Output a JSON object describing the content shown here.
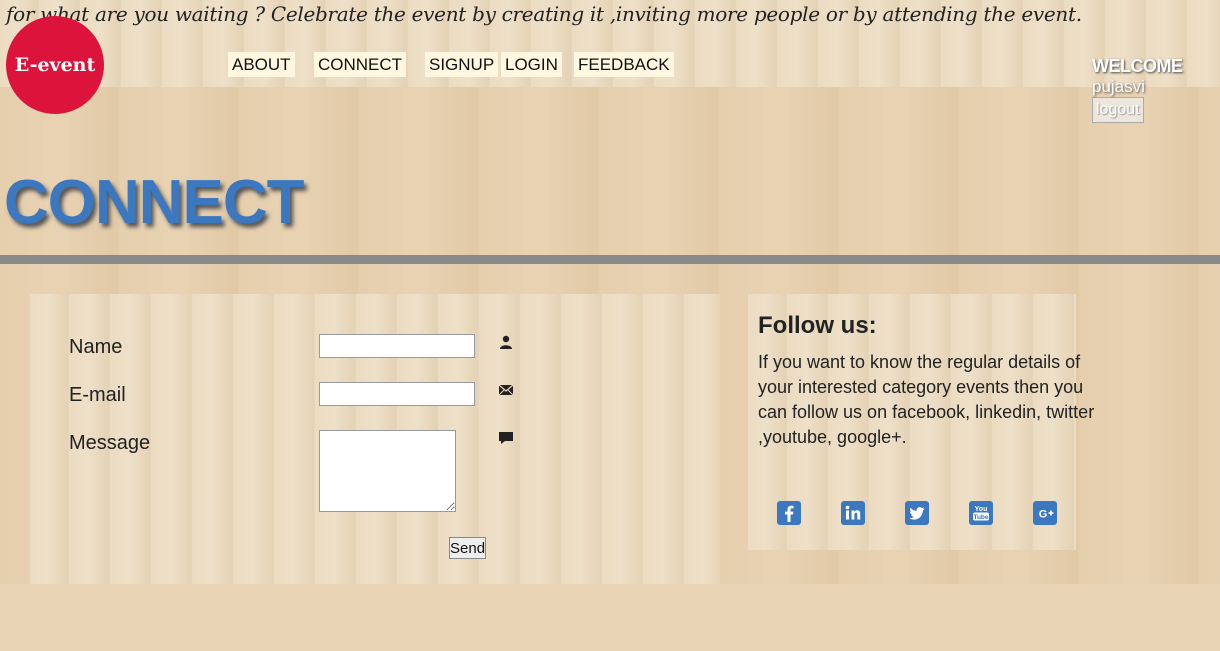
{
  "header": {
    "tagline": "for what are you waiting ? Celebrate the event by creating it ,inviting more people or by attending the event.",
    "logo_text": "E-event",
    "nav": [
      "ABOUT",
      "CONNECT",
      "SIGNUP",
      "LOGIN",
      "FEEDBACK"
    ],
    "welcome": "WELCOME",
    "username": "pujasvi",
    "logout": "logout"
  },
  "page_title": "CONNECT",
  "form": {
    "name_label": "Name",
    "email_label": "E-mail",
    "message_label": "Message",
    "name_value": "",
    "email_value": "",
    "message_value": "",
    "send_label": "Send"
  },
  "follow": {
    "title": "Follow us:",
    "text": "If you want to know the regular details of your interested category events then you can follow us on facebook, linkedin, twitter ,youtube, google+.",
    "icons": [
      "facebook-icon",
      "linkedin-icon",
      "twitter-icon",
      "youtube-icon",
      "google-plus-icon"
    ]
  },
  "colors": {
    "logo_bg": "#dc143c",
    "title": "#3c78c0",
    "divider": "#8a8a8a",
    "social": "#3c78c0"
  }
}
